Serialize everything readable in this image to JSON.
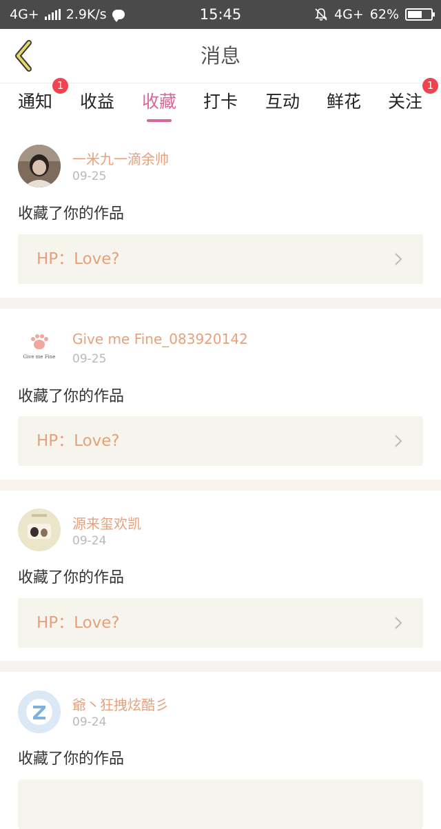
{
  "status_bar": {
    "network_left": "4G+",
    "speed": "2.9K/s",
    "time": "15:45",
    "network_right": "4G+",
    "battery": "62%",
    "battery_level": 0.62
  },
  "header": {
    "title": "消息"
  },
  "tabs": [
    {
      "label": "通知",
      "badge": "1",
      "active": false
    },
    {
      "label": "收益",
      "badge": "",
      "active": false
    },
    {
      "label": "收藏",
      "badge": "",
      "active": true
    },
    {
      "label": "打卡",
      "badge": "",
      "active": false
    },
    {
      "label": "互动",
      "badge": "",
      "active": false
    },
    {
      "label": "鲜花",
      "badge": "",
      "active": false
    },
    {
      "label": "关注",
      "badge": "1",
      "active": false
    }
  ],
  "messages": [
    {
      "user": "一米九一滴余帅",
      "date": "09-25",
      "action": "收藏了你的作品",
      "work": "HP：Love?",
      "avatar": "photo-avatar"
    },
    {
      "user": "Give me Fine_083920142",
      "date": "09-25",
      "action": "收藏了你的作品",
      "work": "HP：Love?",
      "avatar": "paw-avatar",
      "avatar_text": "Give me Fine"
    },
    {
      "user": "源来玺欢凯",
      "date": "09-24",
      "action": "收藏了你的作品",
      "work": "HP：Love?",
      "avatar": "dog-avatar"
    },
    {
      "user": "爺丶狂拽炫酷彡",
      "date": "09-24",
      "action": "收藏了你的作品",
      "work": "",
      "avatar": "default-qq-avatar"
    }
  ],
  "colors": {
    "accent": "#d9669a",
    "name": "#e8a07a",
    "badge": "#ef4350",
    "work_bg": "#f5f4ed"
  }
}
